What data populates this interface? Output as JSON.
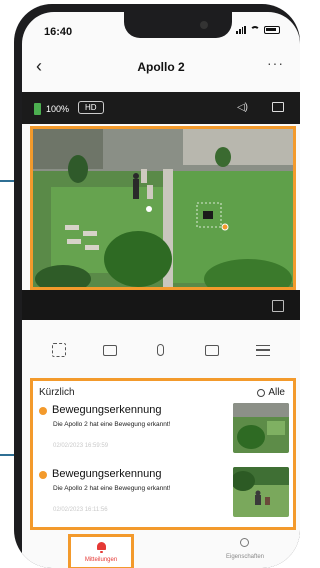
{
  "status_bar": {
    "time": "16:40"
  },
  "header": {
    "back": "‹",
    "title": "Apollo 2",
    "more": "···"
  },
  "camera_bar": {
    "battery_percent": "100%",
    "quality_badge": "HD",
    "speaker_icon": "speaker-icon",
    "fullscreen_icon": "fullscreen-icon"
  },
  "controls": [
    {
      "name": "screenshot-icon"
    },
    {
      "name": "camera-capture-icon"
    },
    {
      "name": "microphone-icon"
    },
    {
      "name": "record-video-icon"
    },
    {
      "name": "menu-icon"
    }
  ],
  "recent": {
    "title": "Kürzlich",
    "all_label": "Alle",
    "events": [
      {
        "title": "Bewegungserkennung",
        "desc": "Die Apollo 2 hat eine Bewegung erkannt!",
        "time": "02/02/2023 16:59:59"
      },
      {
        "title": "Bewegungserkennung",
        "desc": "Die Apollo 2 hat eine Bewegung erkannt!",
        "time": "02/02/2023 16:11:56"
      }
    ]
  },
  "tabs": {
    "notifications_label": "Mitteilungen",
    "properties_label": "Eigenschaften"
  },
  "colors": {
    "highlight": "#f39a2c",
    "alert": "#e53935",
    "battery": "#4caf50"
  }
}
